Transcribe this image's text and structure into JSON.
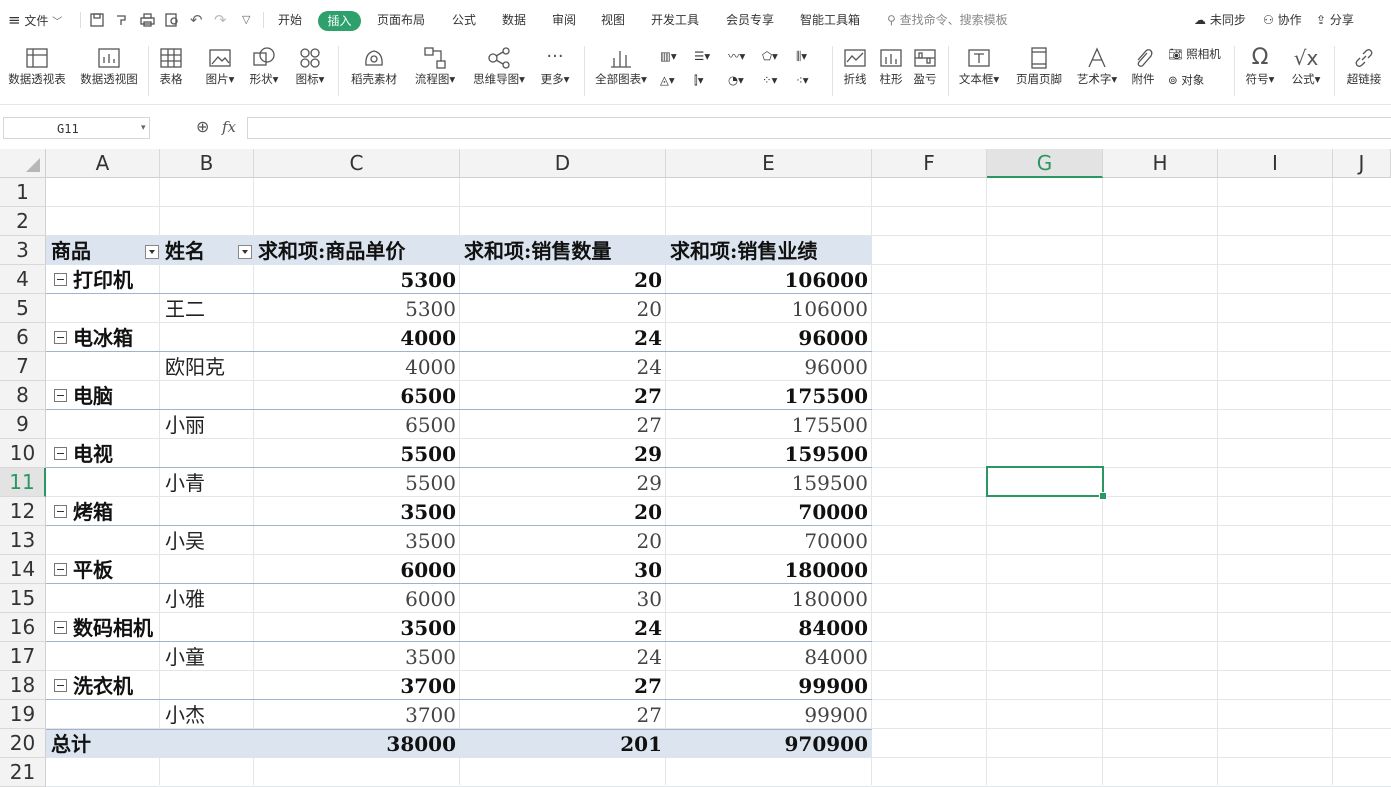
{
  "menubar": {
    "file_label": "文件",
    "tabs": [
      "开始",
      "插入",
      "页面布局",
      "公式",
      "数据",
      "审阅",
      "视图",
      "开发工具",
      "会员专享",
      "智能工具箱"
    ],
    "active_tab": "插入",
    "search_placeholder": "查找命令、搜索模板",
    "sync_label": "未同步",
    "collab_label": "协作",
    "share_label": "分享",
    "accent_color": "#2da06b"
  },
  "ribbon": {
    "pivot_table": "数据透视表",
    "pivot_chart": "数据透视图",
    "table": "表格",
    "picture": "图片",
    "shape": "形状",
    "icon": "图标",
    "docer_material": "稻壳素材",
    "flowchart": "流程图",
    "mindmap": "思维导图",
    "more": "更多",
    "all_charts": "全部图表",
    "line": "折线",
    "column": "柱形",
    "winloss": "盈亏",
    "textbox": "文本框",
    "header_footer": "页眉页脚",
    "wordart": "艺术字",
    "attachment": "附件",
    "camera": "照相机",
    "object": "对象",
    "symbol": "符号",
    "formula": "公式",
    "hyperlink": "超链接"
  },
  "formula_bar": {
    "cell_ref": "G11",
    "fx_label": "fx",
    "content": ""
  },
  "grid": {
    "columns": [
      "A",
      "B",
      "C",
      "D",
      "E",
      "F",
      "G",
      "H",
      "I",
      "J"
    ],
    "selected_column": "G",
    "rows": [
      "1",
      "2",
      "3",
      "4",
      "5",
      "6",
      "7",
      "8",
      "9",
      "10",
      "11",
      "12",
      "13",
      "14",
      "15",
      "16",
      "17",
      "18",
      "19",
      "20",
      "21"
    ],
    "selected_row": "11",
    "selection_color": "#2a9763"
  },
  "pivot": {
    "headers": {
      "product": "商品",
      "name": "姓名",
      "price": "求和项:商品单价",
      "qty": "求和项:销售数量",
      "sales": "求和项:销售业绩"
    },
    "groups": [
      {
        "product": "打印机",
        "name": "王二",
        "price": "5300",
        "qty": "20",
        "sales": "106000"
      },
      {
        "product": "电冰箱",
        "name": "欧阳克",
        "price": "4000",
        "qty": "24",
        "sales": "96000"
      },
      {
        "product": "电脑",
        "name": "小丽",
        "price": "6500",
        "qty": "27",
        "sales": "175500"
      },
      {
        "product": "电视",
        "name": "小青",
        "price": "5500",
        "qty": "29",
        "sales": "159500"
      },
      {
        "product": "烤箱",
        "name": "小吴",
        "price": "3500",
        "qty": "20",
        "sales": "70000"
      },
      {
        "product": "平板",
        "name": "小雅",
        "price": "6000",
        "qty": "30",
        "sales": "180000"
      },
      {
        "product": "数码相机",
        "name": "小童",
        "price": "3500",
        "qty": "24",
        "sales": "84000"
      },
      {
        "product": "洗衣机",
        "name": "小杰",
        "price": "3700",
        "qty": "27",
        "sales": "99900"
      }
    ],
    "total": {
      "label": "总计",
      "price": "38000",
      "qty": "201",
      "sales": "970900"
    },
    "band_color": "#dce4ef"
  }
}
